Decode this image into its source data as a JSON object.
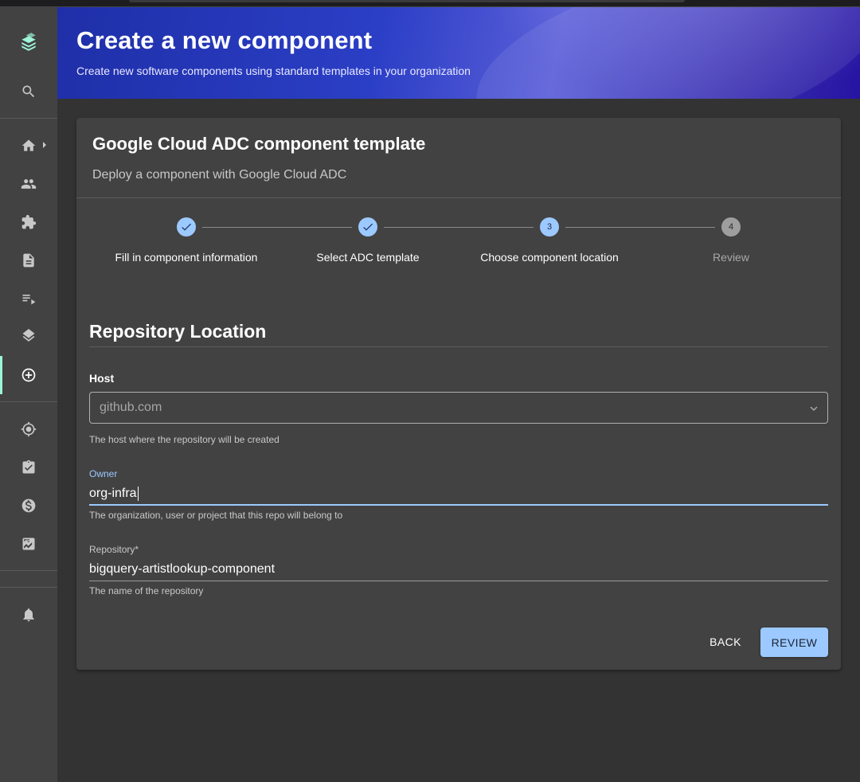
{
  "header": {
    "title": "Create a new component",
    "subtitle": "Create new software components using standard templates in your organization"
  },
  "sidebar": {
    "items": [
      {
        "icon": "logo-icon"
      },
      {
        "icon": "search-icon"
      },
      {
        "icon": "home-icon"
      },
      {
        "icon": "people-icon"
      },
      {
        "icon": "extension-icon"
      },
      {
        "icon": "description-icon"
      },
      {
        "icon": "playlist-icon"
      },
      {
        "icon": "layers-icon"
      },
      {
        "icon": "create-icon",
        "active": true
      },
      {
        "icon": "radar-icon"
      },
      {
        "icon": "checklist-icon"
      },
      {
        "icon": "cost-icon"
      },
      {
        "icon": "score-icon"
      },
      {
        "icon": "notifications-icon"
      }
    ],
    "accent_color": "#9cf4d9"
  },
  "card": {
    "title": "Google Cloud ADC component template",
    "subtitle": "Deploy a component with Google Cloud ADC"
  },
  "stepper": {
    "steps": [
      {
        "label": "Fill in component information",
        "state": "completed",
        "number": "1"
      },
      {
        "label": "Select ADC template",
        "state": "completed",
        "number": "2"
      },
      {
        "label": "Choose component location",
        "state": "active",
        "number": "3"
      },
      {
        "label": "Review",
        "state": "pending",
        "number": "4"
      }
    ],
    "accent_color": "#9cc9ff"
  },
  "form": {
    "section_title": "Repository Location",
    "host": {
      "label": "Host",
      "value": "github.com",
      "helper": "The host where the repository will be created"
    },
    "owner": {
      "label": "Owner",
      "value": "org-infra",
      "helper": "The organization, user or project that this repo will belong to"
    },
    "repository": {
      "label": "Repository*",
      "value": "bigquery-artistlookup-component",
      "helper": "The name of the repository"
    }
  },
  "actions": {
    "back_label": "BACK",
    "review_label": "REVIEW"
  }
}
